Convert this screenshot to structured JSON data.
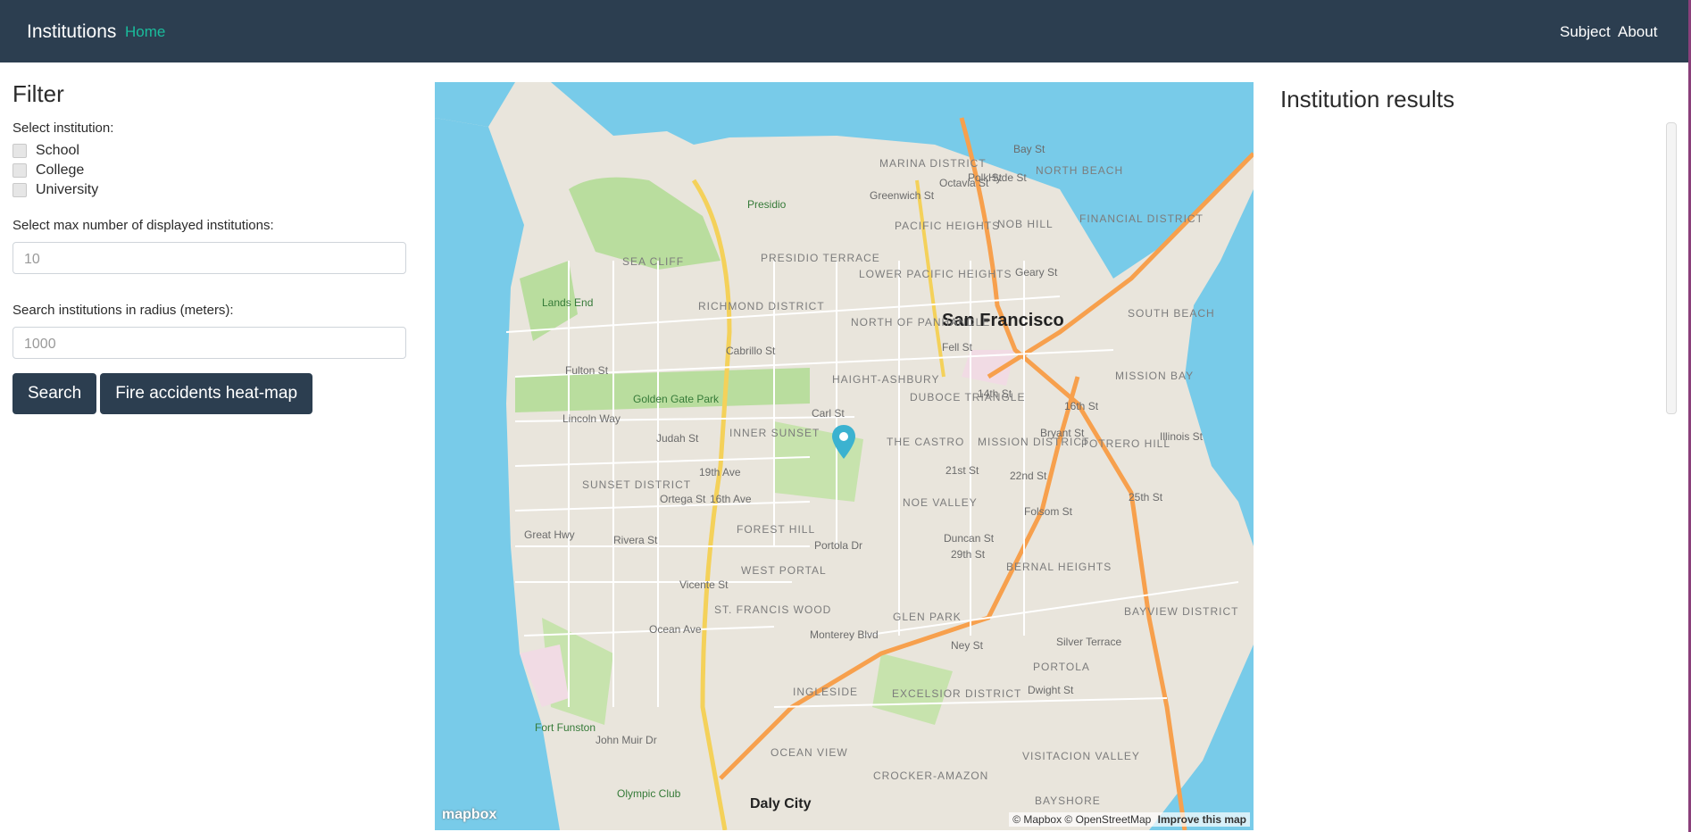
{
  "navbar": {
    "brand": "Institutions",
    "home": "Home",
    "subject": "Subject",
    "about": "About"
  },
  "filter": {
    "title": "Filter",
    "select_institution_label": "Select institution:",
    "institutions": [
      "School",
      "College",
      "University"
    ],
    "max_label": "Select max number of displayed institutions:",
    "max_placeholder": "10",
    "radius_label": "Search institutions in radius (meters):",
    "radius_placeholder": "1000",
    "search_button": "Search",
    "heatmap_button": "Fire accidents heat-map"
  },
  "map": {
    "city": "San Francisco",
    "city_south": "Daly City",
    "districts": [
      "MARINA DISTRICT",
      "PRESIDIO TERRACE",
      "RICHMOND DISTRICT",
      "NORTH OF PANHANDLE",
      "HAIGHT-ASHBURY",
      "INNER SUNSET",
      "SUNSET DISTRICT",
      "THE CASTRO",
      "MISSION DISTRICT",
      "NOE VALLEY",
      "POTRERO HILL",
      "BERNAL HEIGHTS",
      "GLEN PARK",
      "OCEAN VIEW",
      "EXCELSIOR DISTRICT",
      "PORTOLA",
      "VISITACION VALLEY",
      "FOREST HILL",
      "WEST PORTAL",
      "ST. FRANCIS WOOD",
      "INGLESIDE",
      "CROCKER-AMAZON",
      "BAYSHORE",
      "NOB HILL",
      "NORTH BEACH",
      "FINANCIAL DISTRICT",
      "SOUTH BEACH",
      "MISSION BAY",
      "DUBOCE TRIANGLE",
      "LOWER PACIFIC HEIGHTS",
      "PACIFIC HEIGHTS",
      "SEA CLIFF",
      "BAYVIEW DISTRICT"
    ],
    "parks": [
      "Presidio",
      "Lands End",
      "Golden Gate Park",
      "Fort Funston",
      "Olympic Club"
    ],
    "streets": [
      "Bay St",
      "Greenwich St",
      "Geary St",
      "Fulton St",
      "Fell St",
      "Lincoln Way",
      "Judah St",
      "Ortega St",
      "Rivera St",
      "Vicente St",
      "Ocean Ave",
      "Carl St",
      "14th St",
      "16th St",
      "21st St",
      "22nd St",
      "25th St",
      "29th St",
      "Duncan St",
      "Portola Dr",
      "Monterey Blvd",
      "Ney St",
      "Silver Terrace",
      "Dwight St",
      "Great Hwy",
      "19th Ave",
      "16th Ave",
      "Cabrillo St",
      "Polk St",
      "Hyde St",
      "Octavia St",
      "Folsom St",
      "Bryant St",
      "Illinois St",
      "John Muir Dr"
    ],
    "attribution": "© Mapbox © OpenStreetMap",
    "improve": "Improve this map",
    "logo": "mapbox"
  },
  "results": {
    "title": "Institution results"
  }
}
